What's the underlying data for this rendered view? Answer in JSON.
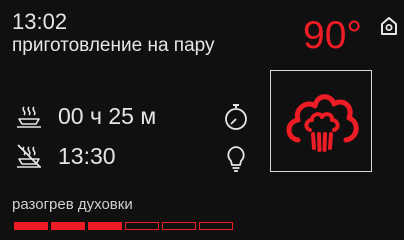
{
  "header": {
    "time": "13:02",
    "mode": "приготовление на пару",
    "temperature": "90°"
  },
  "settings": {
    "duration": "00 ч 25 м",
    "end_time": "13:30"
  },
  "status": {
    "text": "разогрев духовки",
    "progress_total_segments": 6,
    "progress_filled_segments": 3
  },
  "icons": {
    "home": "home-icon",
    "cooking_duration": "steam-dish-icon",
    "end_time": "crossed-dish-icon",
    "timer": "stopwatch-icon",
    "lamp": "lightbulb-icon",
    "program": "steam-cloud-icon"
  },
  "colors": {
    "accent": "#ee1c24",
    "background": "#101010",
    "text": "#e6e6e6"
  }
}
